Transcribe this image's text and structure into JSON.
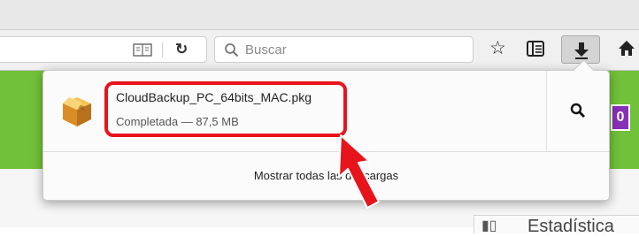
{
  "toolbar": {
    "reader_icon": "reader-view-icon",
    "reload_icon": "reload-icon",
    "search_placeholder": "Buscar",
    "bookmark_icon": "star-icon",
    "library_icon": "library-icon",
    "download_icon": "download-arrow-icon",
    "home_icon": "home-icon"
  },
  "downloads_panel": {
    "item": {
      "icon": "package-icon",
      "file_name": "CloudBackup_PC_64bits_MAC.pkg",
      "status": "Completada — 87,5 MB",
      "action_icon": "magnifier-icon"
    },
    "show_all_label": "Mostrar todas las descargas"
  },
  "background_page": {
    "badge_text": "0",
    "stats_tab_label": "Estadística"
  },
  "colors": {
    "accent_green": "#72c13a",
    "highlight_red": "#e8141c",
    "badge_purple": "#8a2fb8"
  }
}
